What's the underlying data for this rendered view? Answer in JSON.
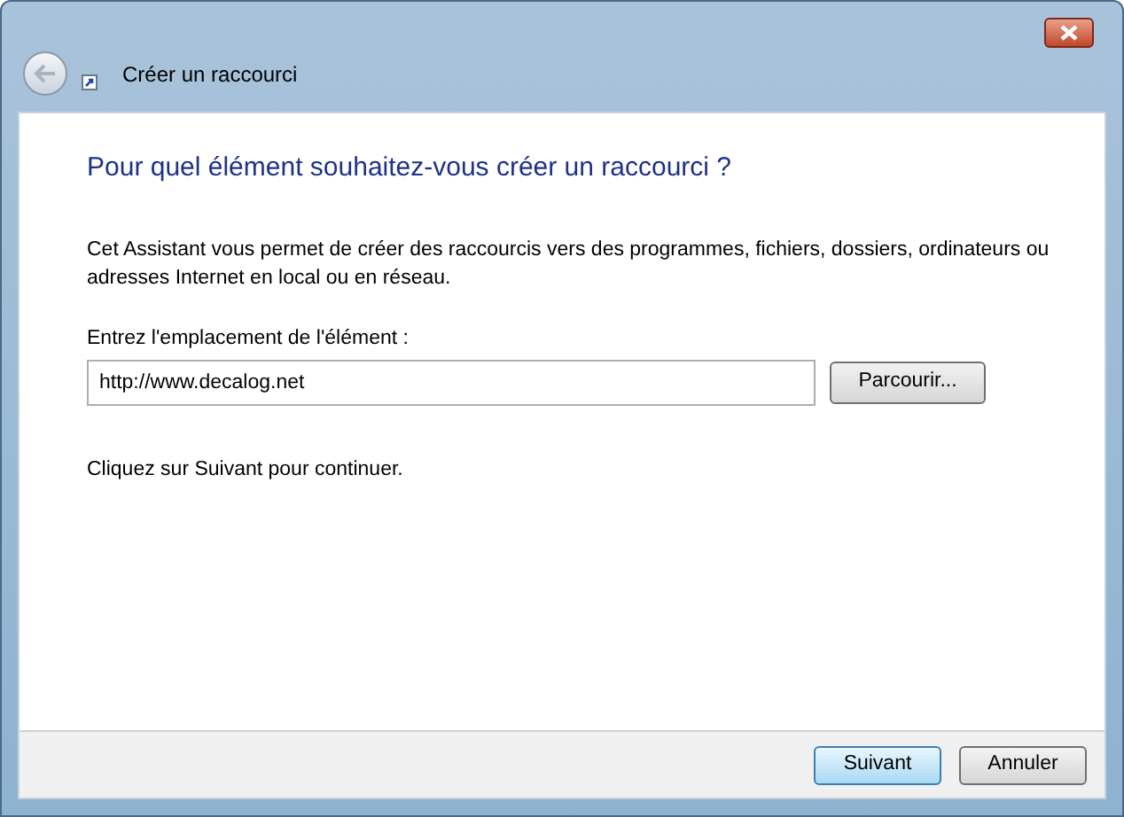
{
  "window": {
    "title": "Créer un raccourci"
  },
  "heading": "Pour quel élément souhaitez-vous créer un raccourci ?",
  "description": "Cet Assistant vous permet de créer des raccourcis vers des programmes, fichiers, dossiers, ordinateurs ou adresses Internet en local ou en réseau.",
  "location": {
    "label": "Entrez l'emplacement de l'élément :",
    "value": "http://www.decalog.net",
    "browse_button": "Parcourir..."
  },
  "hint": "Cliquez sur Suivant pour continuer.",
  "buttons": [
    {
      "label": "Suivant",
      "selected": true
    },
    {
      "label": "Annuler",
      "selected": false
    }
  ]
}
